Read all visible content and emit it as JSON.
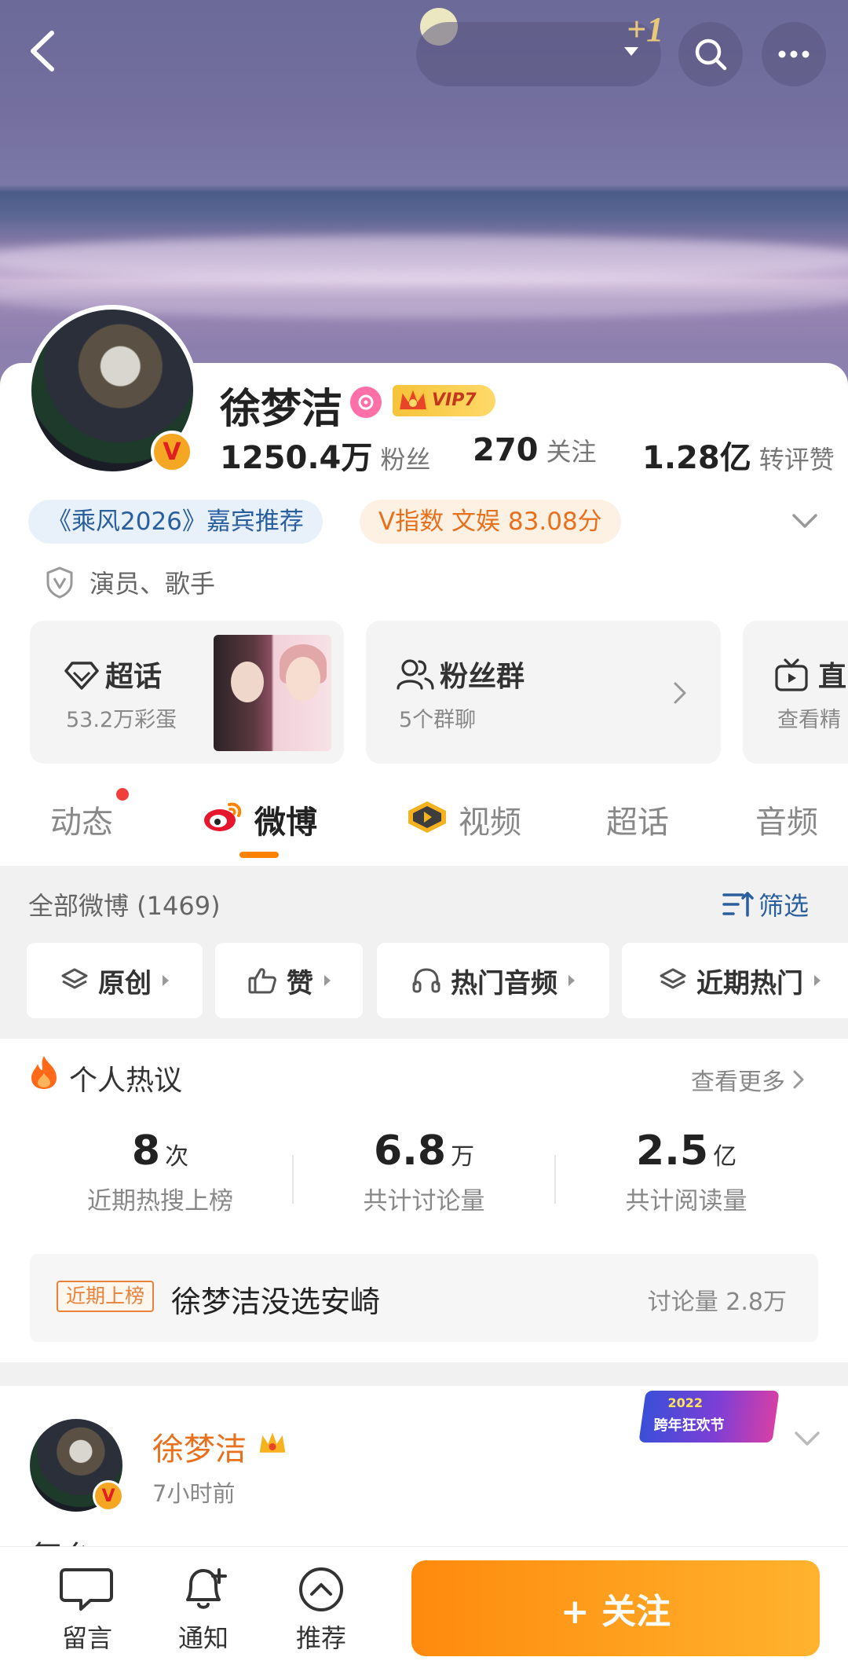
{
  "header": {
    "badge_text": "+1"
  },
  "profile": {
    "name": "徐梦洁",
    "vip_label": "VIP7",
    "stats": [
      {
        "num": "1250.4万",
        "label": "粉丝"
      },
      {
        "num": "270",
        "label": "关注"
      },
      {
        "num": "1.28亿",
        "label": "转评赞"
      }
    ],
    "tags": {
      "show_tag": "《乘风2026》嘉宾推荐",
      "v_index": "V指数 文娱 83.08分"
    },
    "role": "演员、歌手"
  },
  "cards": {
    "super_topic": {
      "title": "超话",
      "sub": "53.2万彩蛋"
    },
    "fan_group": {
      "title": "粉丝群",
      "sub": "5个群聊"
    },
    "live": {
      "title": "直",
      "sub": "查看精"
    }
  },
  "tabs": [
    {
      "label": "动态"
    },
    {
      "label": "微博"
    },
    {
      "label": "视频"
    },
    {
      "label": "超话"
    },
    {
      "label": "音频"
    }
  ],
  "feed_filter": {
    "all_label": "全部微博 (1469)",
    "filter_label": "筛选",
    "chips": [
      {
        "label": "原创"
      },
      {
        "label": "赞"
      },
      {
        "label": "热门音频"
      },
      {
        "label": "近期热门"
      }
    ]
  },
  "hot": {
    "title": "个人热议",
    "see_more": "查看更多",
    "stats": [
      {
        "num": "8",
        "unit": "次",
        "desc": "近期热搜上榜"
      },
      {
        "num": "6.8",
        "unit": "万",
        "desc": "共计讨论量"
      },
      {
        "num": "2.5",
        "unit": "亿",
        "desc": "共计阅读量"
      }
    ],
    "trend": {
      "badge": "近期上榜",
      "text": "徐梦洁没选安崎",
      "count": "讨论量 2.8万"
    }
  },
  "post": {
    "author": "徐梦洁",
    "time": "7小时前",
    "banner_year": "2022",
    "banner_text": "跨年狂欢节",
    "peek_text": "舞台"
  },
  "bottom_bar": {
    "items": [
      {
        "label": "留言"
      },
      {
        "label": "通知"
      },
      {
        "label": "推荐"
      }
    ],
    "follow_label": "+ 关注"
  },
  "colors": {
    "accent": "#ff8200",
    "link_blue": "#2a5f9e",
    "name_orange": "#e8701d"
  }
}
